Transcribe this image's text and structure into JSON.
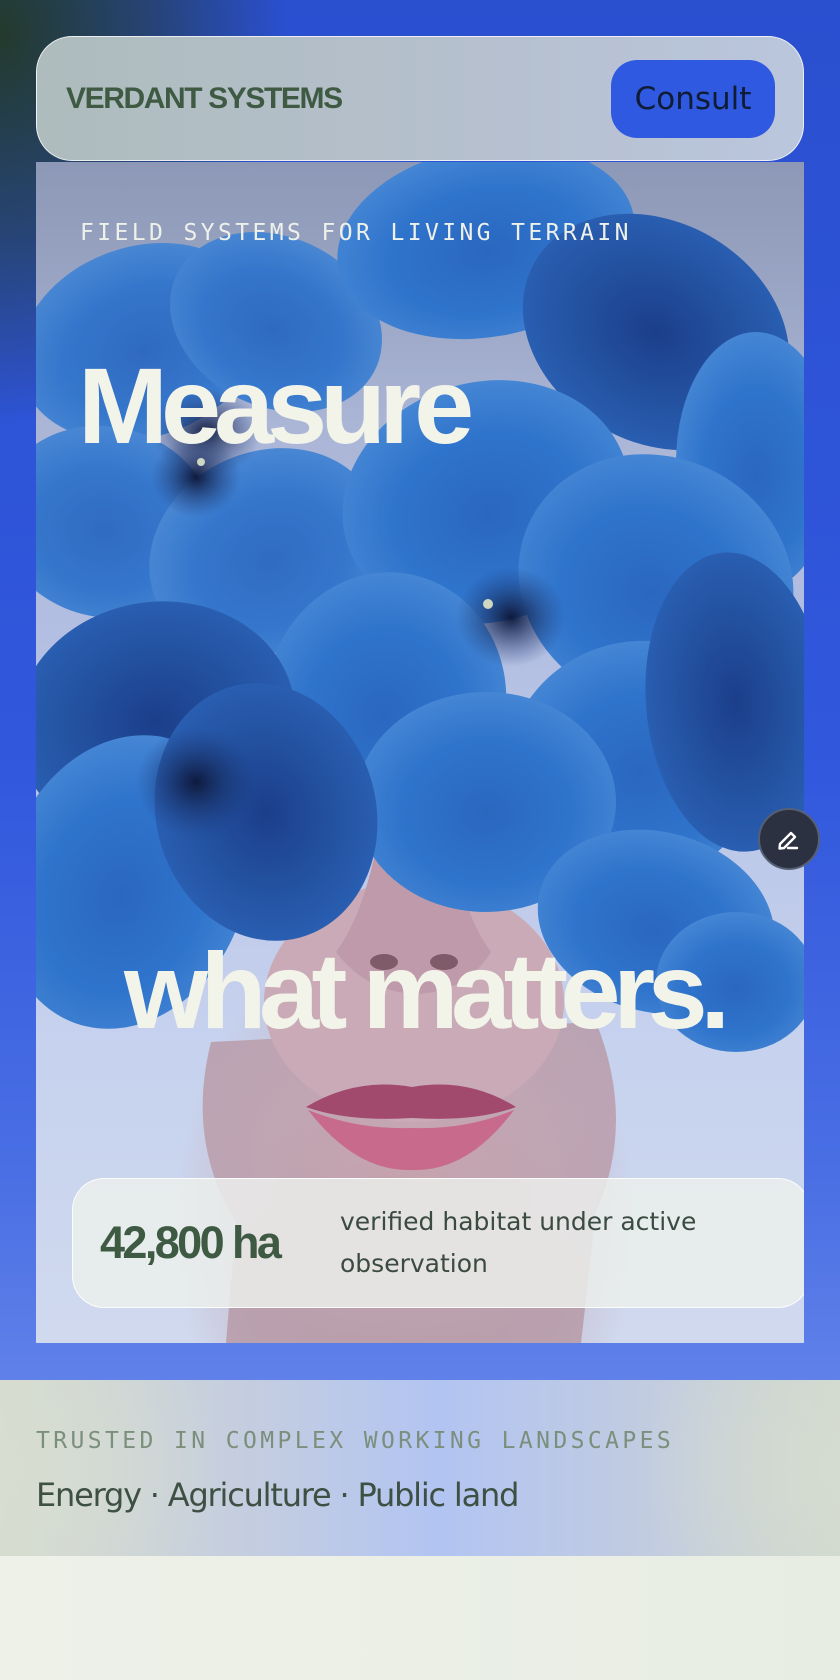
{
  "header": {
    "brand": "VERDANT SYSTEMS",
    "cta_label": "Consult"
  },
  "hero": {
    "eyebrow": "FIELD SYSTEMS FOR LIVING TERRAIN",
    "headline_line1": "Measure",
    "headline_line2": "what matters.",
    "image_subject": "Portrait of a woman with blue flowers covering her eyes",
    "stat": {
      "value": "42,800 ha",
      "description": "verified habitat under active observation"
    }
  },
  "trusted": {
    "label": "TRUSTED IN COMPLEX WORKING LANDSCAPES",
    "industries": "Energy · Agriculture · Public land"
  },
  "floating_action": {
    "icon": "pencil-icon"
  },
  "colors": {
    "brand_green": "#3e5a43",
    "accent_blue": "#2f59e0",
    "page_blue": "#3157dd",
    "headline_ivory": "#f2f3e9"
  }
}
